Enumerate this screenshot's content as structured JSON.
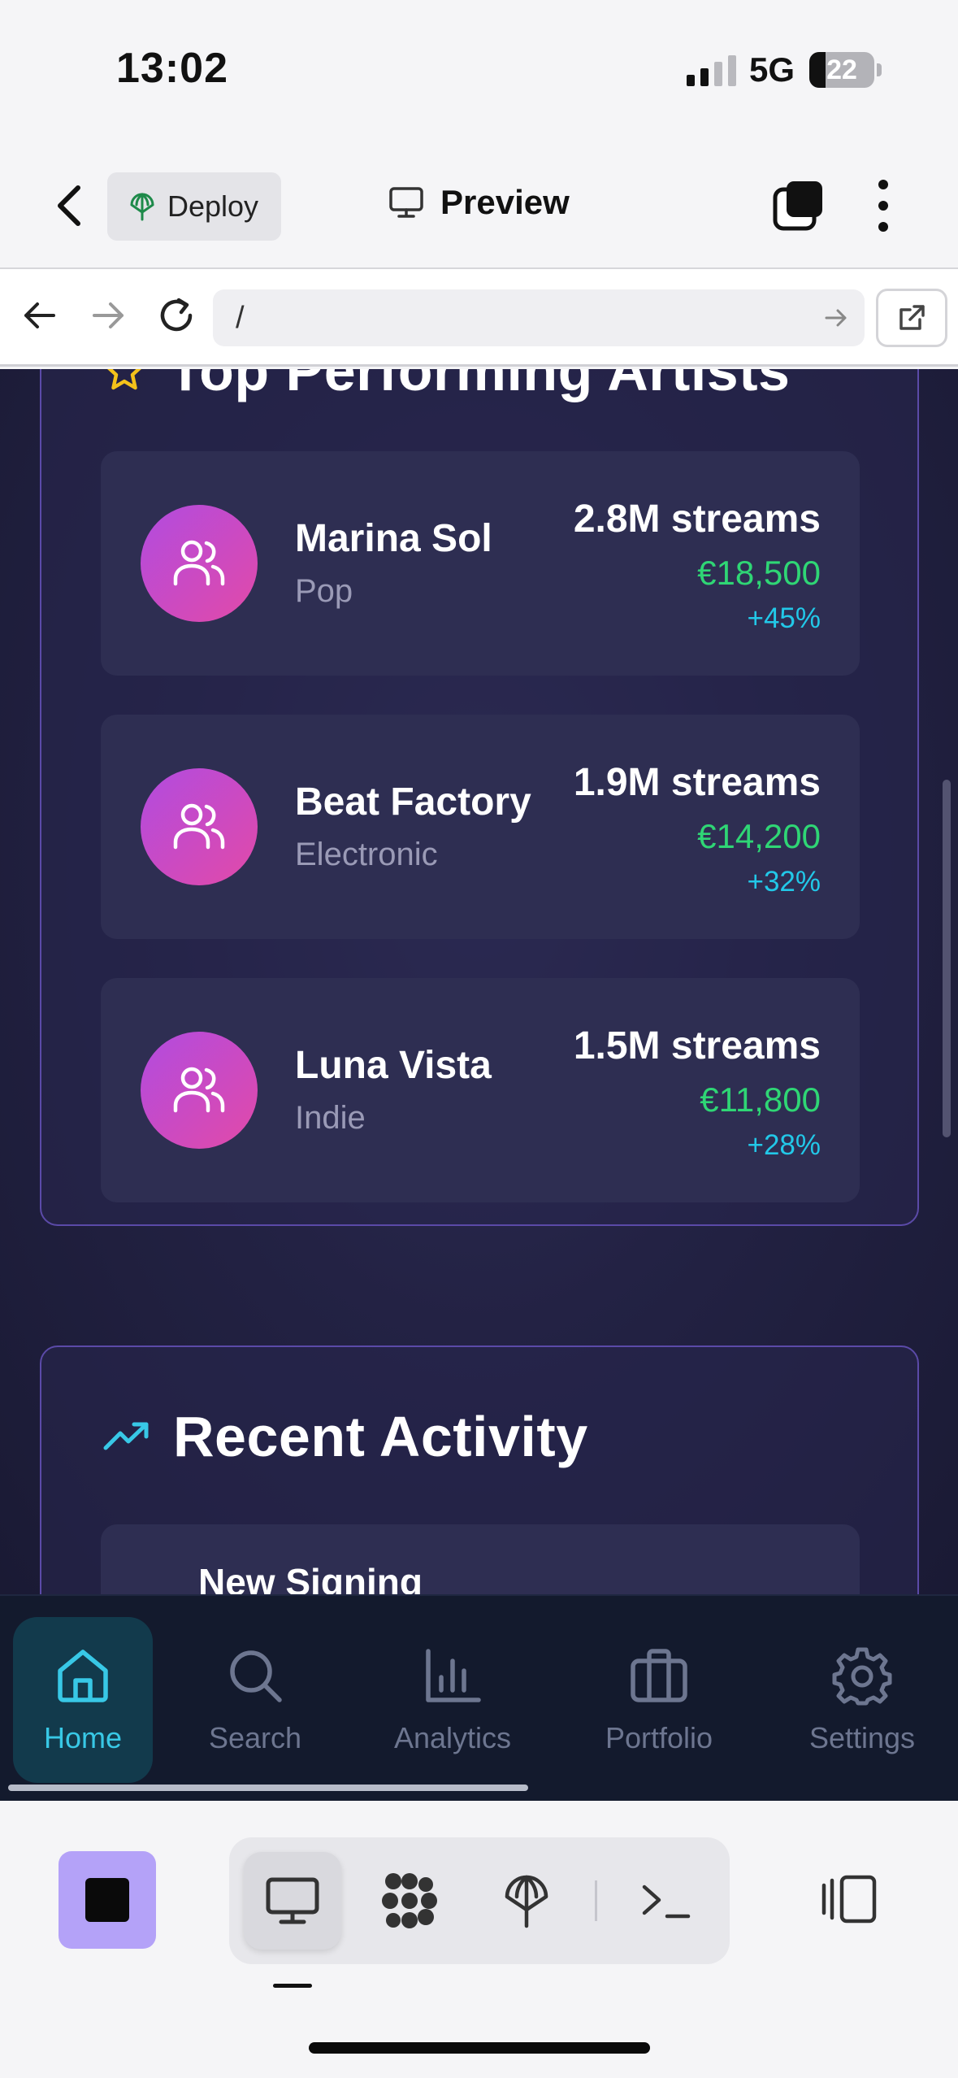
{
  "status_bar": {
    "time": "13:02",
    "network": "5G",
    "battery": "22"
  },
  "toolbar": {
    "deploy_label": "Deploy",
    "preview_label": "Preview"
  },
  "url_bar": {
    "url": "/"
  },
  "top_artists": {
    "title": "Top Performing Artists",
    "artists": [
      {
        "name": "Marina Sol",
        "genre": "Pop",
        "streams": "2.8M streams",
        "revenue": "€18,500",
        "growth": "+45%"
      },
      {
        "name": "Beat Factory",
        "genre": "Electronic",
        "streams": "1.9M streams",
        "revenue": "€14,200",
        "growth": "+32%"
      },
      {
        "name": "Luna Vista",
        "genre": "Indie",
        "streams": "1.5M streams",
        "revenue": "€11,800",
        "growth": "+28%"
      }
    ]
  },
  "recent_activity": {
    "title": "Recent Activity",
    "items": [
      {
        "title": "New Signing"
      }
    ]
  },
  "tab_bar": {
    "tabs": [
      {
        "label": "Home",
        "icon": "home-icon",
        "active": true
      },
      {
        "label": "Search",
        "icon": "search-icon",
        "active": false
      },
      {
        "label": "Analytics",
        "icon": "bar-chart-icon",
        "active": false
      },
      {
        "label": "Portfolio",
        "icon": "briefcase-icon",
        "active": false
      },
      {
        "label": "Settings",
        "icon": "gear-icon",
        "active": false
      }
    ]
  },
  "colors": {
    "accent_cyan": "#38c8e6",
    "revenue_green": "#2fd675",
    "card_border": "#5b4aa8",
    "avatar_gradient": [
      "#b14be0",
      "#e24aa8"
    ],
    "stop_button": "#b4a2f8"
  }
}
